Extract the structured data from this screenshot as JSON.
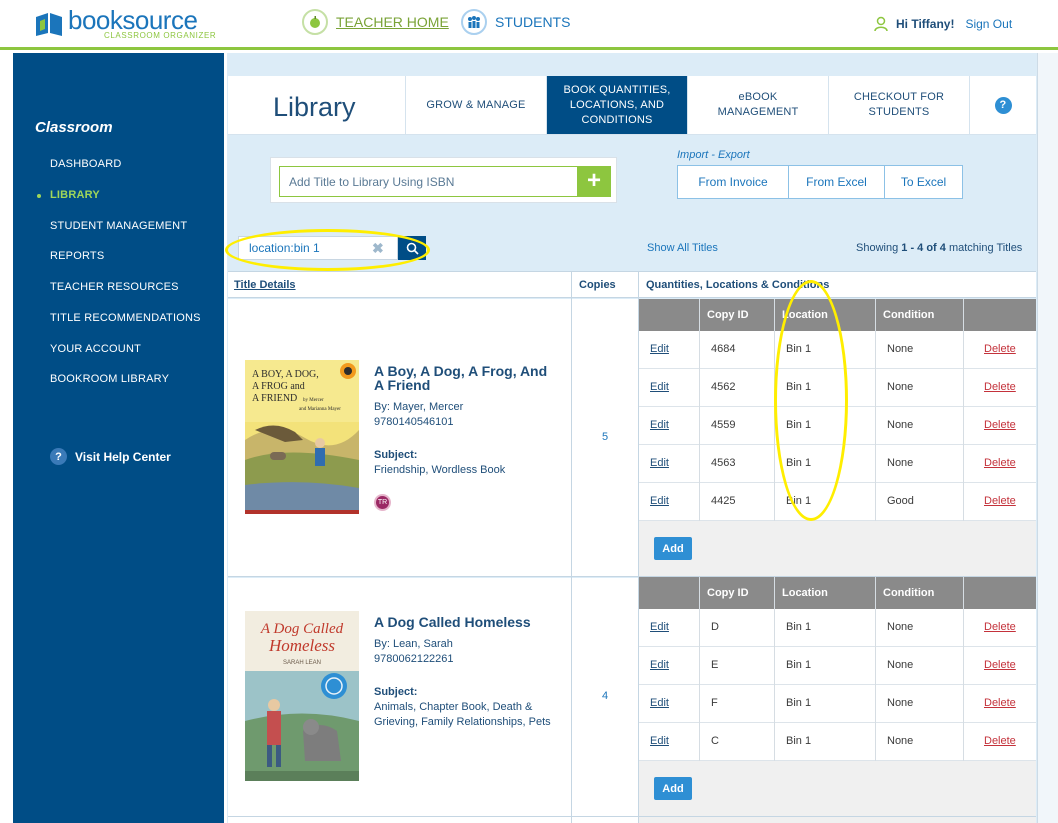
{
  "header": {
    "logo_name": "booksource",
    "logo_sub": "CLASSROOM ORGANIZER",
    "nav": [
      {
        "label": "TEACHER HOME",
        "icon": "apple-icon"
      },
      {
        "label": "STUDENTS",
        "icon": "people-icon"
      }
    ],
    "greeting": "Hi Tiffany!",
    "signout": "Sign Out"
  },
  "sidebar": {
    "heading": "Classroom",
    "items": [
      {
        "label": "DASHBOARD"
      },
      {
        "label": "LIBRARY",
        "active": true
      },
      {
        "label": "STUDENT MANAGEMENT"
      },
      {
        "label": "REPORTS"
      },
      {
        "label": "TEACHER RESOURCES"
      },
      {
        "label": "TITLE RECOMMENDATIONS"
      },
      {
        "label": "YOUR ACCOUNT"
      },
      {
        "label": "BOOKROOM LIBRARY"
      }
    ],
    "help": "Visit Help Center"
  },
  "page": {
    "title": "Library",
    "tabs": [
      {
        "label": "GROW & MANAGE"
      },
      {
        "label": "BOOK QUANTITIES, LOCATIONS, AND CONDITIONS",
        "active": true
      },
      {
        "label": "eBOOK MANAGEMENT"
      },
      {
        "label": "CHECKOUT FOR STUDENTS"
      }
    ],
    "help_icon": "?"
  },
  "isbn": {
    "placeholder": "Add Title to Library Using ISBN",
    "add": "+"
  },
  "import_export": {
    "label": "Import - Export",
    "buttons": [
      "From Invoice",
      "From Excel",
      "To Excel"
    ]
  },
  "search": {
    "value": "location:bin 1",
    "show_all": "Show All Titles",
    "showing_prefix": "Showing ",
    "showing_range": "1 - 4 of 4",
    "showing_suffix": " matching Titles"
  },
  "columns": {
    "title_details": "Title Details",
    "copies": "Copies",
    "qlc": "Quantities, Locations & Conditions"
  },
  "subheaders": {
    "copy_id": "Copy ID",
    "location": "Location",
    "condition": "Condition"
  },
  "labels": {
    "edit": "Edit",
    "delete": "Delete",
    "add": "Add",
    "subject": "Subject:"
  },
  "books": [
    {
      "title_line1": "A Boy, A Dog, A Frog, And",
      "title_line2": "A Friend",
      "author": "By: Mayer, Mercer",
      "isbn": "9780140546101",
      "subject": "Friendship, Wordless Book",
      "badge": "TR",
      "copies": "5",
      "cover_text": "A BOY, A DOG, A FROG and A FRIEND",
      "cover_byline": "by Mercer and Marianna Mayer",
      "rows": [
        {
          "id": "4684",
          "location": "Bin 1",
          "condition": "None"
        },
        {
          "id": "4562",
          "location": "Bin 1",
          "condition": "None"
        },
        {
          "id": "4559",
          "location": "Bin 1",
          "condition": "None"
        },
        {
          "id": "4563",
          "location": "Bin 1",
          "condition": "None"
        },
        {
          "id": "4425",
          "location": "Bin 1",
          "condition": "Good"
        }
      ]
    },
    {
      "title_line1": "A Dog Called Homeless",
      "author": "By: Lean, Sarah",
      "isbn": "9780062122261",
      "subject_line1": "Animals, Chapter Book, Death &",
      "subject_line2": "Grieving, Family Relationships, Pets",
      "copies": "4",
      "cover_text": "A Dog Called Homeless",
      "cover_byline": "SARAH LEAN",
      "rows": [
        {
          "id": "D",
          "location": "Bin 1",
          "condition": "None"
        },
        {
          "id": "E",
          "location": "Bin 1",
          "condition": "None"
        },
        {
          "id": "F",
          "location": "Bin 1",
          "condition": "None"
        },
        {
          "id": "C",
          "location": "Bin 1",
          "condition": "None"
        }
      ]
    }
  ],
  "colors": {
    "brand_blue": "#1b75bb",
    "sidebar_navy": "#004d86",
    "accent_green": "#8dc63f",
    "highlight_yellow": "#ffee00",
    "delete_red": "#c4323b"
  }
}
